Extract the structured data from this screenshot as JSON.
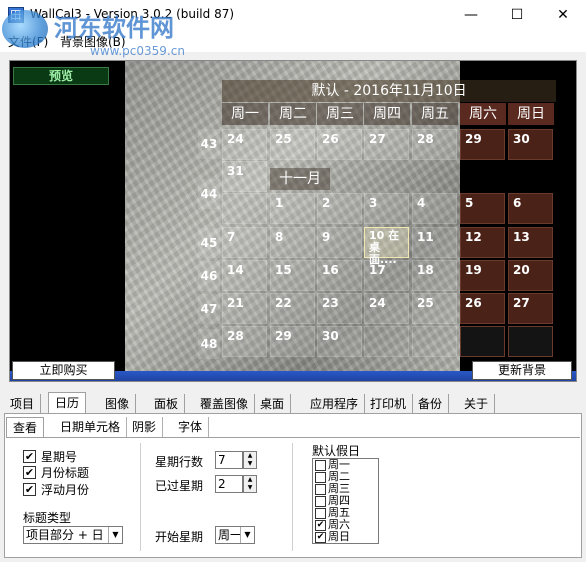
{
  "window": {
    "title": "WallCal3 - Version 3.0.2 (build 87)",
    "minimize": "—",
    "maximize": "☐",
    "close": "✕"
  },
  "watermark": {
    "main": "河东软件网",
    "sub": "www.pc0359.cn"
  },
  "menu": [
    {
      "label": "文件(F)"
    },
    {
      "label": "背景图像(B)"
    }
  ],
  "preview": {
    "label": "预览",
    "buy_button": "立即购买",
    "update_button": "更新背景"
  },
  "calendar": {
    "header": "默认 - 2016年11月10日",
    "month_label": "十一月",
    "weekdays": [
      "周一",
      "周二",
      "周三",
      "周四",
      "周五",
      "周六",
      "周日"
    ],
    "week_numbers": [
      "43",
      "44",
      "45",
      "46",
      "47",
      "48"
    ],
    "rows": [
      [
        "24",
        "25",
        "26",
        "27",
        "28",
        "29",
        "30"
      ],
      [
        "31",
        "",
        "",
        "",
        "",
        "",
        ""
      ],
      [
        "",
        "1",
        "2",
        "3",
        "4",
        "5",
        "6"
      ],
      [
        "7",
        "8",
        "9",
        "10 在桌面....",
        "11",
        "12",
        "13"
      ],
      [
        "14",
        "15",
        "16",
        "17",
        "18",
        "19",
        "20"
      ],
      [
        "21",
        "22",
        "23",
        "24",
        "25",
        "26",
        "27"
      ],
      [
        "28",
        "29",
        "30",
        "",
        "",
        "",
        ""
      ]
    ]
  },
  "main_tabs": [
    "项目",
    "日历",
    "图像",
    "面板",
    "覆盖图像",
    "桌面",
    "应用程序",
    "打印机",
    "备份",
    "关于"
  ],
  "active_main_tab": "日历",
  "sub_tabs": [
    "查看",
    "日期单元格",
    "阴影",
    "字体"
  ],
  "active_sub_tab": "查看",
  "view": {
    "checkboxes": [
      {
        "label": "星期号",
        "checked": true
      },
      {
        "label": "月份标题",
        "checked": true
      },
      {
        "label": "浮动月份",
        "checked": true
      }
    ],
    "title_type_label": "标题类型",
    "title_type_value": "项目部分 + 日",
    "weeks_rows_label": "星期行数",
    "weeks_rows_value": "7",
    "past_weeks_label": "已过星期",
    "past_weeks_value": "2",
    "start_week_label": "开始星期",
    "start_week_value": "周一",
    "holidays_label": "默认假日",
    "holidays": [
      {
        "label": "周一",
        "checked": false
      },
      {
        "label": "周二",
        "checked": false
      },
      {
        "label": "周三",
        "checked": false
      },
      {
        "label": "周四",
        "checked": false
      },
      {
        "label": "周五",
        "checked": false
      },
      {
        "label": "周六",
        "checked": true
      },
      {
        "label": "周日",
        "checked": true
      }
    ]
  },
  "colors": {
    "weekend_cell": "#4a2218",
    "taskbar": "#2a58c8",
    "accent": "#2c72c8"
  }
}
